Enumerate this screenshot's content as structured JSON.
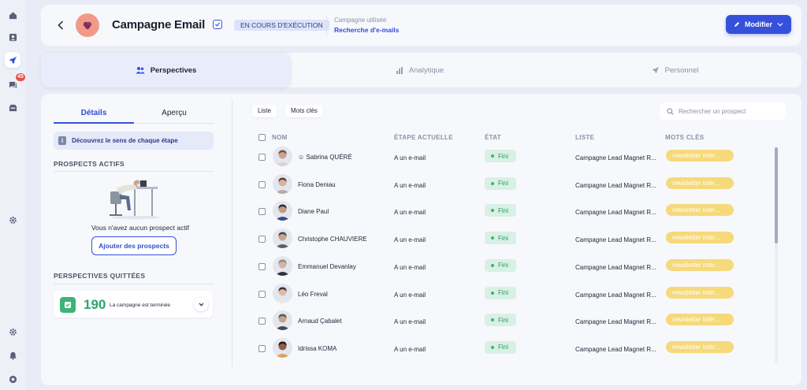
{
  "header": {
    "title": "Campagne Email",
    "status": "EN COURS D'EXÉCUTION",
    "campaign_used_label": "Campagne utilisée",
    "campaign_used_value": "Recherche d'e-mails",
    "modify_label": "Modifier"
  },
  "sidebar": {
    "badge": "45",
    "icons": [
      "home-icon",
      "contacts-icon",
      "rocket-icon",
      "messages-icon",
      "inbox-icon",
      "settings-icon",
      "settings-icon",
      "bell-icon",
      "help-icon"
    ]
  },
  "tabs": [
    {
      "label": "Perspectives",
      "icon": "people-icon",
      "active": true
    },
    {
      "label": "Analytique",
      "icon": "chart-icon",
      "active": false
    },
    {
      "label": "Personnel",
      "icon": "rocket-icon",
      "active": false
    }
  ],
  "left": {
    "subtabs": [
      "Détails",
      "Aperçu"
    ],
    "discover": "Découvrez le sens de chaque étape",
    "active_title": "PROSPECTS ACTIFS",
    "empty_text": "Vous n'avez aucun prospect actif",
    "add_button": "Ajouter des prospects",
    "quit_title": "PERSPECTIVES QUITTÉES",
    "quit_count": "190",
    "quit_text": "La campagne est terminée"
  },
  "toolbar": {
    "list_label": "Liste",
    "keywords_label": "Mots clés",
    "search_placeholder": "Rechercher un prospect"
  },
  "table": {
    "columns": [
      "NOM",
      "ÉTAPE ACTUELLE",
      "ÉTAT",
      "LISTE",
      "MOTS CLÉS"
    ],
    "rows": [
      {
        "name": "Sabrina QUÉRÉ",
        "prefix": "☺",
        "step": "A un e-mail",
        "state": "Fini",
        "list": "Campagne Lead Magnet R...",
        "keyword": "newsletter intér...",
        "skin": "#c9a48c",
        "hair": "#6b5648",
        "shirt": "#d9d4ce"
      },
      {
        "name": "Fiona Deniau",
        "step": "A un e-mail",
        "state": "Fini",
        "list": "Campagne Lead Magnet R...",
        "keyword": "newsletter intér...",
        "skin": "#d8b29a",
        "hair": "#5a3f33",
        "shirt": "#b5aaa6"
      },
      {
        "name": "Diane Paul",
        "step": "A un e-mail",
        "state": "Fini",
        "list": "Campagne Lead Magnet R...",
        "keyword": "newsletter intér...",
        "skin": "#c59a80",
        "hair": "#2a2a3a",
        "shirt": "#3b4a8a"
      },
      {
        "name": "Christophe CHAUVIERE",
        "step": "A un e-mail",
        "state": "Fini",
        "list": "Campagne Lead Magnet R...",
        "keyword": "newsletter intér...",
        "skin": "#c8a48e",
        "hair": "#4a4444",
        "shirt": "#5b6068"
      },
      {
        "name": "Emmanuel Devanlay",
        "step": "A un e-mail",
        "state": "Fini",
        "list": "Campagne Lead Magnet R...",
        "keyword": "newsletter intér...",
        "skin": "#d7b49e",
        "hair": "#8b8b8b",
        "shirt": "#2d3040"
      },
      {
        "name": "Léo Freval",
        "step": "A un e-mail",
        "state": "Fini",
        "list": "Campagne Lead Magnet R...",
        "keyword": "newsletter intér...",
        "skin": "#dcbca6",
        "hair": "#3a3030",
        "shirt": "#e8e8ea"
      },
      {
        "name": "Arnaud Çabalet",
        "step": "A un e-mail",
        "state": "Fini",
        "list": "Campagne Lead Magnet R...",
        "keyword": "newsletter intér...",
        "skin": "#c6a38e",
        "hair": "#5c5550",
        "shirt": "#3f4a5a"
      },
      {
        "name": "Idrissa KOMA",
        "step": "A un e-mail",
        "state": "Fini",
        "list": "Campagne Lead Magnet R...",
        "keyword": "newsletter intér...",
        "skin": "#8a5e44",
        "hair": "#1e1a1a",
        "shirt": "#e0a05a"
      }
    ]
  },
  "colors": {
    "accent": "#3550db",
    "success": "#3cb478",
    "keyword": "#f6d97a",
    "badge": "#e8514a"
  }
}
